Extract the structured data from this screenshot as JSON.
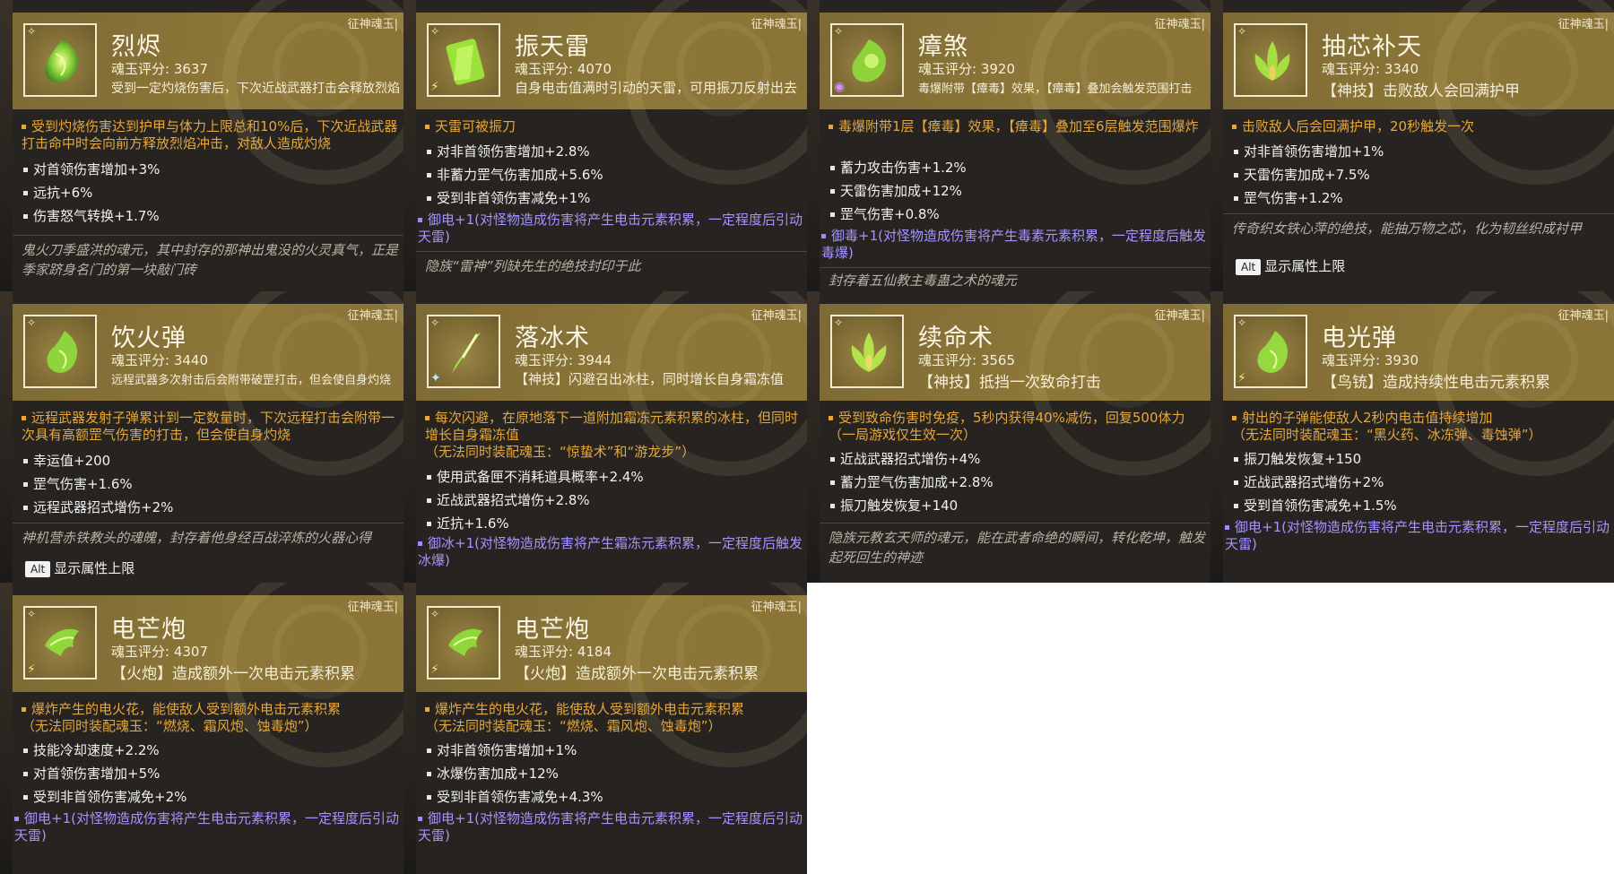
{
  "tag": "征神魂玉|",
  "alt": {
    "key": "Alt",
    "label": "显示属性上限"
  },
  "cards": [
    {
      "name": "烈烬",
      "score": "魂玉评分: 3637",
      "brief": "受到一定灼烧伤害后，下次近战武器打击会释放烈焰",
      "effect": "受到灼烧伤害达到护甲与体力上限总和10%后，下次近战武器打击命中时会向前方释放烈焰冲击，对敌人造成灼烧",
      "stats": [
        "对首领伤害增加+3%",
        "远抗+6%",
        "伤害怒气转换+1.7%"
      ],
      "bonus": "",
      "flavor": "鬼火刀季盛洪的魂元，其中封存的那神出鬼没的火灵真气，正是季家跻身名门的第一块敲门砖"
    },
    {
      "name": "振天雷",
      "score": "魂玉评分: 4070",
      "brief": "自身电击值满时引动的天雷，可用振刀反射出去",
      "effect": "天雷可被振刀",
      "stats": [
        "对非首领伤害增加+2.8%",
        "非蓄力罡气伤害加成+5.6%",
        "受到非首领伤害减免+1%"
      ],
      "bonus": "御电+1(对怪物造成伤害将产生电击元素积累，一定程度后引动天雷)",
      "flavor": "隐族“雷神”列缺先生的绝技封印于此"
    },
    {
      "name": "瘴煞",
      "score": "魂玉评分: 3920",
      "brief": "毒爆附带【瘴毒】效果，【瘴毒】叠加会触发范围打击",
      "effect": "毒爆附带1层【瘴毒】效果，【瘴毒】叠加至6层触发范围爆炸",
      "stats": [
        "蓄力攻击伤害+1.2%",
        "天雷伤害加成+12%",
        "罡气伤害+0.8%"
      ],
      "bonus": "御毒+1(对怪物造成伤害将产生毒素元素积累，一定程度后触发毒爆)",
      "flavor": "封存着五仙教主毒蛊之术的魂元"
    },
    {
      "name": "抽芯补天",
      "score": "魂玉评分: 3340",
      "brief": "【神技】击败敌人会回满护甲",
      "effect": "击败敌人后会回满护甲，20秒触发一次",
      "stats": [
        "对非首领伤害增加+1%",
        "天雷伤害加成+7.5%",
        "罡气伤害+1.2%"
      ],
      "bonus": "",
      "flavor": "传奇织女铁心萍的绝技，能抽万物之芯，化为韧丝织成衬甲"
    },
    {
      "name": "饮火弹",
      "score": "魂玉评分: 3440",
      "brief": "远程武器多次射击后会附带破罡打击，但会使自身灼烧",
      "effect": "远程武器发射子弹累计到一定数量时，下次远程打击会附带一次具有高额罡气伤害的打击，但会使自身灼烧",
      "stats": [
        "幸运值+200",
        "罡气伤害+1.6%",
        "远程武器招式增伤+2%"
      ],
      "bonus": "",
      "flavor": "神机营赤铁教头的魂魄，封存着他身经百战淬炼的火器心得"
    },
    {
      "name": "落冰术",
      "score": "魂玉评分: 3944",
      "brief": "【神技】闪避召出冰柱，同时增长自身霜冻值",
      "effect": "每次闪避，在原地落下一道附加霜冻元素积累的冰柱，但同时增长自身霜冻值\n（无法同时装配魂玉：“惊蛰术”和“游龙步”）",
      "stats": [
        "使用武备匣不消耗道具概率+2.4%",
        "近战武器招式增伤+2.8%",
        "近抗+1.6%"
      ],
      "bonus": "御冰+1(对怪物造成伤害将产生霜冻元素积累，一定程度后触发冰爆)",
      "flavor": ""
    },
    {
      "name": "续命术",
      "score": "魂玉评分: 3565",
      "brief": "【神技】抵挡一次致命打击",
      "effect": "受到致命伤害时免疫，5秒内获得40%减伤，回复500体力（一局游戏仅生效一次）",
      "stats": [
        "近战武器招式增伤+4%",
        "蓄力罡气伤害加成+2.8%",
        "振刀触发恢复+140"
      ],
      "bonus": "",
      "flavor": "隐族元教玄天师的魂元，能在武者命绝的瞬间，转化乾坤，触发起死回生的神迹"
    },
    {
      "name": "电光弹",
      "score": "魂玉评分: 3930",
      "brief": "【鸟铳】造成持续性电击元素积累",
      "effect": "射出的子弹能使敌人2秒内电击值持续增加\n（无法同时装配魂玉：“黑火药、冰冻弹、毒蚀弹”）",
      "stats": [
        "振刀触发恢复+150",
        "近战武器招式增伤+2%",
        "受到首领伤害减免+1.5%"
      ],
      "bonus": "御电+1(对怪物造成伤害将产生电击元素积累，一定程度后引动天雷)",
      "flavor": ""
    },
    {
      "name": "电芒炮",
      "score": "魂玉评分: 4307",
      "brief": "【火炮】造成额外一次电击元素积累",
      "effect": "爆炸产生的电火花，能使敌人受到额外电击元素积累\n（无法同时装配魂玉：“燃烧、霜风炮、蚀毒炮”）",
      "stats": [
        "技能冷却速度+2.2%",
        "对首领伤害增加+5%",
        "受到非首领伤害减免+2%"
      ],
      "bonus": "御电+1(对怪物造成伤害将产生电击元素积累，一定程度后引动天雷)",
      "flavor": ""
    },
    {
      "name": "电芒炮",
      "score": "魂玉评分: 4184",
      "brief": "【火炮】造成额外一次电击元素积累",
      "effect": "爆炸产生的电火花，能使敌人受到额外电击元素积累\n（无法同时装配魂玉：“燃烧、霜风炮、蚀毒炮”）",
      "stats": [
        "对非首领伤害增加+1%",
        "冰爆伤害加成+12%",
        "受到非首领伤害减免+4.3%"
      ],
      "bonus": "御电+1(对怪物造成伤害将产生电击元素积累，一定程度后引动天雷)",
      "flavor": ""
    }
  ]
}
